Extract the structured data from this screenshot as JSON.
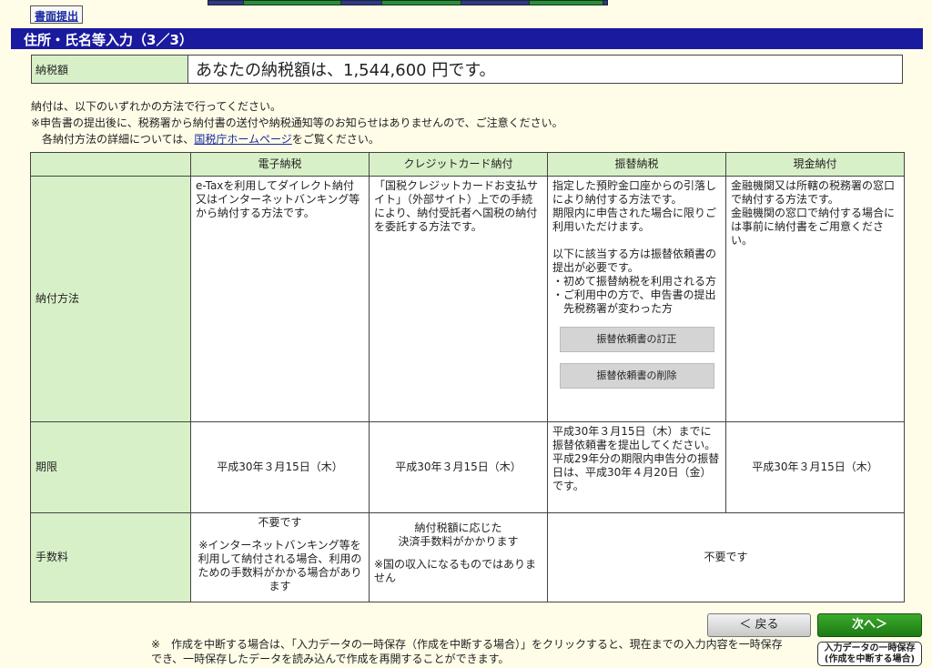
{
  "header": {
    "paper_button": "書面提出",
    "section_title": "住所・氏名等入力（3／3）"
  },
  "tax": {
    "label": "納税額",
    "value": "あなたの納税額は、1,544,600 円です。"
  },
  "notes": {
    "line1": "納付は、以下のいずれかの方法で行ってください。",
    "line2": "※申告書の提出後に、税務署から納付書の送付や納税通知等のお知らせはありませんので、ご注意ください。",
    "line3_prefix": "各納付方法の詳細については、",
    "line3_link": "国税庁ホームページ",
    "line3_suffix": "をご覧ください。"
  },
  "methods": {
    "columns": [
      "電子納税",
      "クレジットカード納付",
      "振替納税",
      "現金納付"
    ],
    "rows": {
      "method": {
        "label": "納付方法",
        "etax": "e-Taxを利用してダイレクト納付又はインターネットバンキング等から納付する方法です。",
        "credit": "「国税クレジットカードお支払サイト」（外部サイト）上での手続により、納付受託者へ国税の納付を委託する方法です。",
        "transfer_1": "指定した預貯金口座からの引落しにより納付する方法です。",
        "transfer_2": "期限内に申告された場合に限りご利用いただけます。",
        "transfer_3": "以下に該当する方は振替依頼書の提出が必要です。",
        "transfer_b1": "・初めて振替納税を利用される方",
        "transfer_b2": "・ご利用中の方で、申告書の提出先税務署が変わった方",
        "btn_correct": "振替依頼書の訂正",
        "btn_delete": "振替依頼書の削除",
        "cash_1": "金融機関又は所轄の税務署の窓口で納付する方法です。",
        "cash_2": "金融機関の窓口で納付する場合には事前に納付書をご用意ください。"
      },
      "deadline": {
        "label": "期限",
        "etax": "平成30年３月15日（木）",
        "credit": "平成30年３月15日（木）",
        "transfer_1": "平成30年３月15日（木）までに振替依頼書を提出してください。",
        "transfer_2": "平成29年分の期限内申告分の振替日は、平成30年４月20日（金）です。",
        "cash": "平成30年３月15日（木）"
      },
      "fee": {
        "label": "手数料",
        "etax_1": "不要です",
        "etax_2": "※インターネットバンキング等を利用して納付される場合、利用のための手数料がかかる場合があります",
        "credit_1": "納付税額に応じた",
        "credit_2": "決済手数料がかかります",
        "credit_3": "※国の収入になるものではありません",
        "rest": "不要です"
      }
    }
  },
  "footer": {
    "note": "※　作成を中断する場合は、「入力データの一時保存（作成を中断する場合）」をクリックすると、現在までの入力内容を一時保存でき、一時保存したデータを読み込んで作成を再開することができます。",
    "back": "＜ 戻る",
    "next": "次へ＞",
    "save_line1": "入力データの一時保存",
    "save_line2": "(作成を中断する場合)"
  }
}
